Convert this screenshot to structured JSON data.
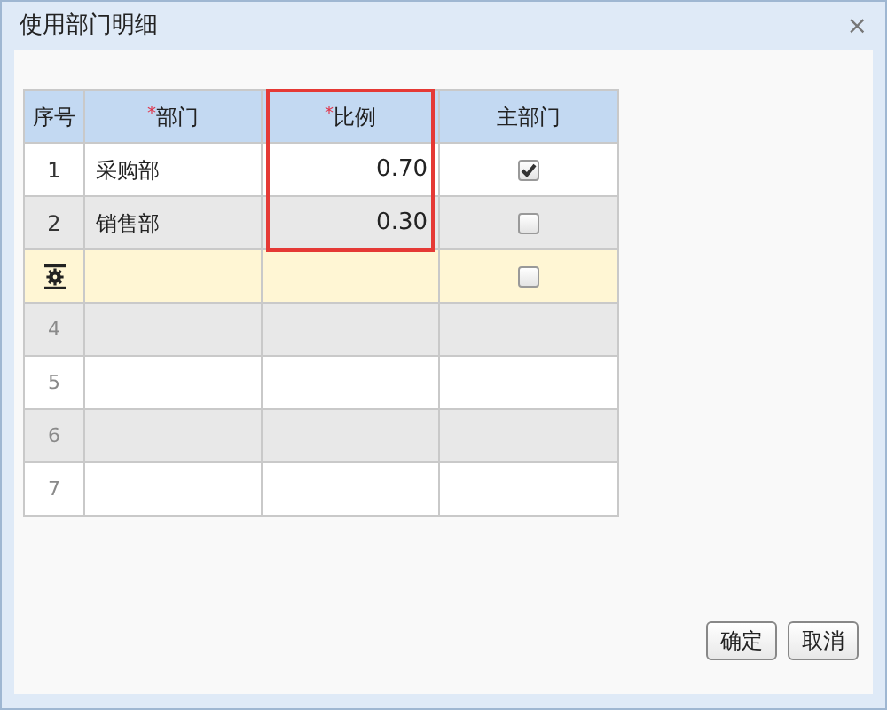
{
  "window": {
    "title": "使用部门明细",
    "close": "×"
  },
  "table": {
    "columns": [
      {
        "label": "序号",
        "highlighted": false
      },
      {
        "label": "部门",
        "required_mark": "*",
        "highlighted": false
      },
      {
        "label": "比例",
        "required_mark": "*",
        "highlighted": true
      },
      {
        "label": "主部门",
        "highlighted": false
      }
    ],
    "rows": [
      {
        "kind": "data",
        "no": "1",
        "department": "采购部",
        "ratio": "0.70",
        "checked": true,
        "selected": false
      },
      {
        "kind": "data",
        "no": "2",
        "department": "销售部",
        "ratio": "0.30",
        "checked": false,
        "selected": false
      },
      {
        "kind": "new",
        "checked": false,
        "selected": true
      },
      {
        "kind": "empty",
        "no": "4",
        "selected": false
      },
      {
        "kind": "empty",
        "no": "5",
        "selected": false
      },
      {
        "kind": "empty",
        "no": "6",
        "selected": false
      },
      {
        "kind": "empty",
        "no": "7",
        "selected": false
      }
    ]
  },
  "buttons": [
    "确定",
    "取消"
  ]
}
